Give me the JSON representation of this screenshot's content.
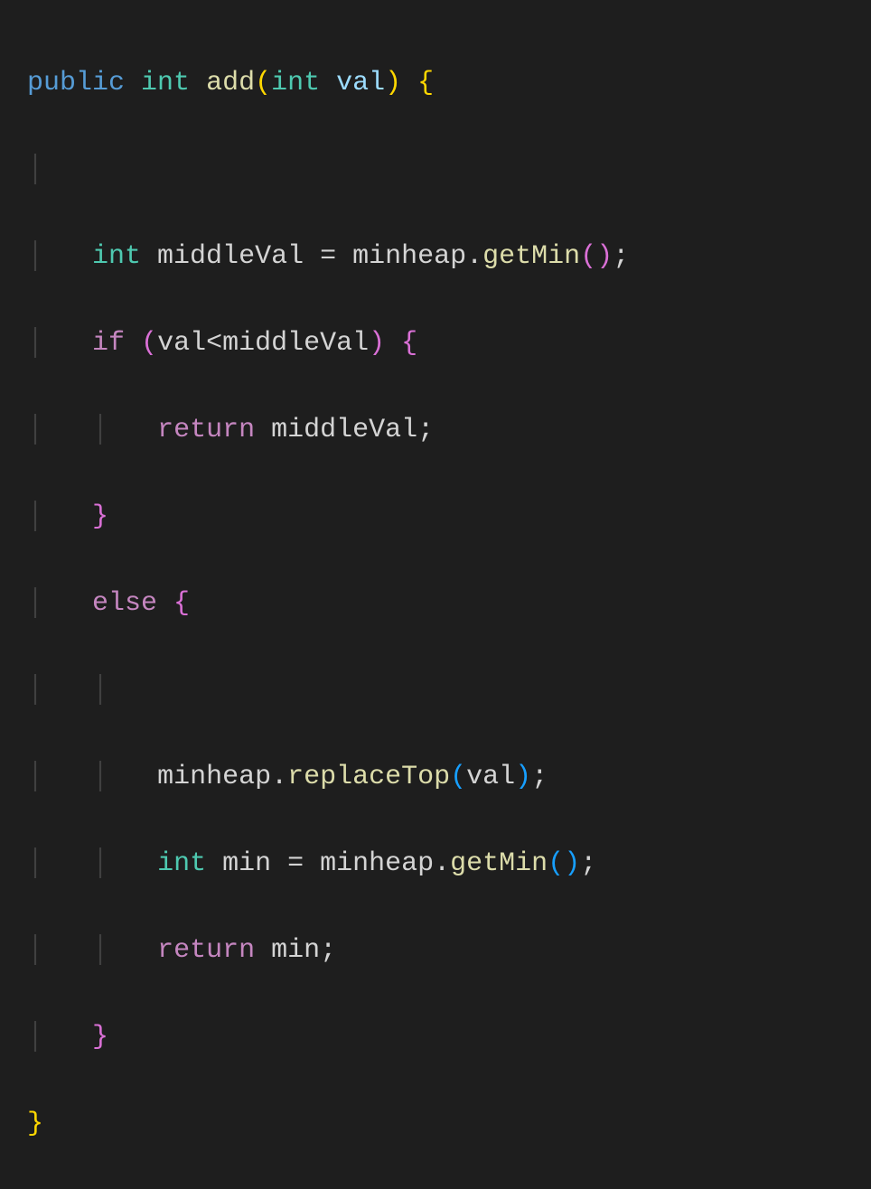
{
  "code": {
    "l1": {
      "kw_access": "public",
      "kw_type": "int",
      "fn_name": "add",
      "paren_open": "(",
      "param_type": "int",
      "param_name": "val",
      "paren_close": ")",
      "brace": " {"
    },
    "l3": {
      "indent": "    ",
      "kw_type": "int",
      "var": " middleVal ",
      "op": "=",
      "obj": " minheap",
      "dot": ".",
      "method": "getMin",
      "parens": "()",
      "semi": ";"
    },
    "l4": {
      "indent": "    ",
      "kw_if": "if",
      "paren_open": " (",
      "cond": "val<middleVal",
      "paren_close": ")",
      "brace": " {"
    },
    "l5": {
      "indent": "        ",
      "kw_return": "return",
      "var": " middleVal",
      "semi": ";"
    },
    "l6": {
      "indent": "    ",
      "brace": "}"
    },
    "l7": {
      "indent": "    ",
      "kw_else": "else",
      "brace": " {"
    },
    "l9": {
      "indent": "        ",
      "obj": "minheap",
      "dot": ".",
      "method": "replaceTop",
      "paren_open": "(",
      "arg": "val",
      "paren_close": ")",
      "semi": ";"
    },
    "l10": {
      "indent": "        ",
      "kw_type": "int",
      "var": " min ",
      "op": "=",
      "obj": " minheap",
      "dot": ".",
      "method": "getMin",
      "parens": "()",
      "semi": ";"
    },
    "l11": {
      "indent": "        ",
      "kw_return": "return",
      "var": " min",
      "semi": ";"
    },
    "l12": {
      "indent": "    ",
      "brace": "}"
    },
    "l13": {
      "brace": "}"
    }
  }
}
